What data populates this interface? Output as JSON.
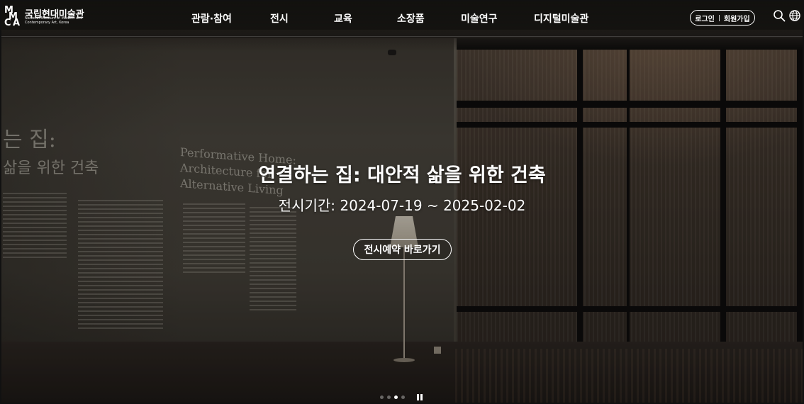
{
  "header": {
    "logo": {
      "korean_name": "국립현대미술관",
      "english_name": "National Museum of Modern and Contemporary Art, Korea",
      "mark_letters": [
        "M",
        "M",
        "C",
        "A"
      ]
    },
    "nav": [
      {
        "label": "관람·참여"
      },
      {
        "label": "전시"
      },
      {
        "label": "교육"
      },
      {
        "label": "소장품"
      },
      {
        "label": "미술연구"
      },
      {
        "label": "디지털미술관"
      }
    ],
    "auth": {
      "login_label": "로그인",
      "signup_label": "회원가입"
    },
    "icons": {
      "search": "search-icon",
      "language": "globe-icon"
    }
  },
  "hero": {
    "title": "연결하는 집: 대안적 삶을 위한 건축",
    "period": "전시기간: 2024-07-19 ~ 2025-02-02",
    "cta_label": "전시예약 바로가기",
    "wall_heading_ko_1": "는 집:",
    "wall_heading_ko_2": "삶을 위한 건축",
    "wall_heading_en_1": "Performative Home:",
    "wall_heading_en_2": "Architecture for Alternative Living"
  },
  "carousel": {
    "slide_count": 4,
    "active_index": 2,
    "control_icon": "pause-icon"
  },
  "colors": {
    "text": "#ffffff",
    "dot_inactive": "rgba(255,255,255,0.35)",
    "dot_active": "#ffffff"
  }
}
